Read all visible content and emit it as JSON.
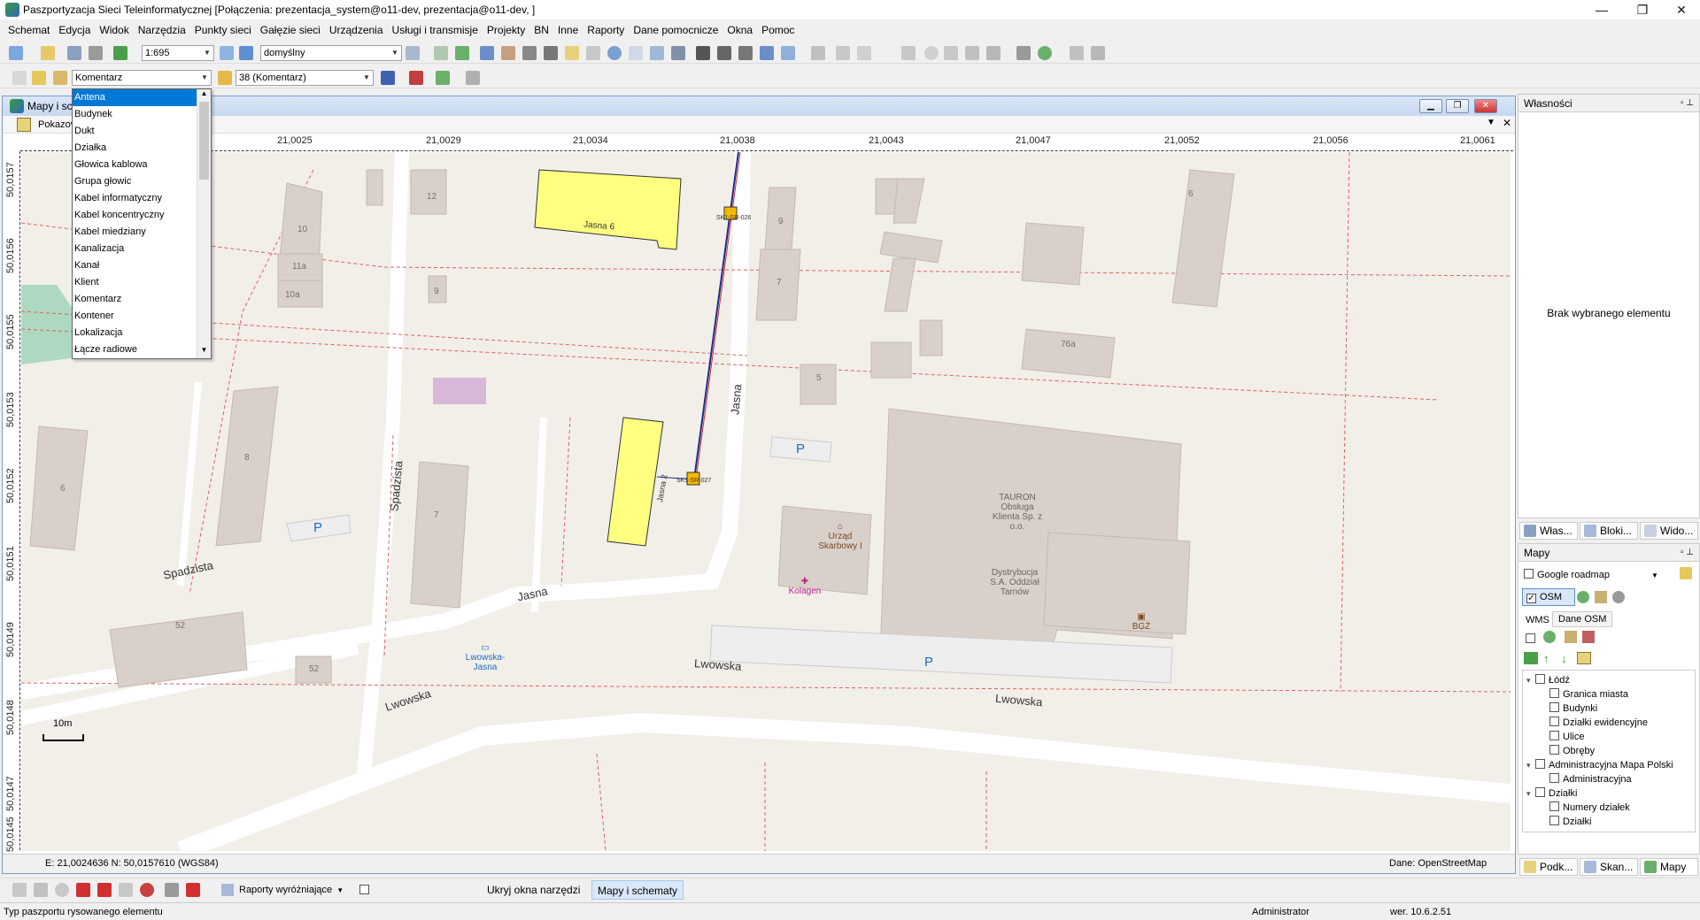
{
  "app": {
    "title": "Paszportyzacja Sieci Teleinformatycznej [Połączenia: prezentacja_system@o11-dev, prezentacja@o11-dev, ]",
    "window_buttons": [
      "—",
      "❐",
      "✕"
    ]
  },
  "menu": [
    "Schemat",
    "Edycja",
    "Widok",
    "Narzędzia",
    "Punkty sieci",
    "Gałęzie sieci",
    "Urządzenia",
    "Usługi i transmisje",
    "Projekty",
    "BN",
    "Inne",
    "Raporty",
    "Dane pomocnicze",
    "Okna",
    "Pomoc"
  ],
  "toolbar1": {
    "scale_value": "1:695",
    "style_value": "domyślny"
  },
  "toolbar2": {
    "type_value": "Komentarz",
    "layer_value": "38 (Komentarz)"
  },
  "dropdown": {
    "items": [
      "Antena",
      "Budynek",
      "Dukt",
      "Działka",
      "Głowica kablowa",
      "Grupa głowic",
      "Kabel informatyczny",
      "Kabel koncentryczny",
      "Kabel miedziany",
      "Kanalizacja",
      "Kanał",
      "Klient",
      "Komentarz",
      "Kontener",
      "Lokalizacja",
      "Łącze radiowe"
    ],
    "selected": "Antena"
  },
  "mdi": {
    "title": "Mapy i sc",
    "sub_label": "Pokazov",
    "coords": "E: 21,0024636  N: 50,0157610 (WGS84)",
    "data_source": "Dane: OpenStreetMap",
    "scale_bar": "10m"
  },
  "ruler_top": [
    "21,0025",
    "21,0029",
    "21,0034",
    "21,0038",
    "21,0043",
    "21,0047",
    "21,0052",
    "21,0056",
    "21,0061"
  ],
  "ruler_left": [
    "50,0157",
    "50,0156",
    "50,0155",
    "50,0153",
    "50,0152",
    "50,0151",
    "50,0149",
    "50,0148",
    "50,0147",
    "50,0145"
  ],
  "map_labels": {
    "streets": [
      "Spadzista",
      "Spadzista",
      "Jasna",
      "Jasna",
      "Jasna",
      "Lwowska",
      "Lwowska",
      "Lwowska"
    ],
    "house_numbers": [
      "12",
      "10",
      "11a",
      "10a",
      "9",
      "8",
      "6",
      "7",
      "52",
      "52",
      "9",
      "7",
      "5",
      "6",
      "76a"
    ],
    "jasna6": "Jasna 6",
    "jasna_small": "Jasna 2",
    "sk1": "SK1-SR-026",
    "sk2": "SK1-SR-027",
    "parking": [
      "P",
      "P",
      "P"
    ],
    "poi_office": "Urząd Skarbowy I",
    "poi_tauron": "TAURON Obsługa Klienta Sp. z o.o.",
    "poi_dystr": "Dystrybucja S.A. Oddział Tarnów",
    "poi_kolagen": "Kolagen",
    "poi_bgz": "BGŻ",
    "poi_bus": "Lwowska-Jasna"
  },
  "right_panel": {
    "props_title": "Własności",
    "props_empty": "Brak wybranego elementu",
    "tabs1": [
      "Włas...",
      "Bloki...",
      "Wido..."
    ],
    "maps_title": "Mapy",
    "google_label": "Google roadmap",
    "osm_label": "OSM",
    "sub_tabs": [
      "WMS",
      "Dane OSM"
    ],
    "tree": [
      {
        "label": "Łódź",
        "level": 0,
        "toggle": "▾",
        "checked": false
      },
      {
        "label": "Granica miasta",
        "level": 1,
        "checked": false
      },
      {
        "label": "Budynki",
        "level": 1,
        "checked": false
      },
      {
        "label": "Działki ewidencyjne",
        "level": 1,
        "checked": false
      },
      {
        "label": "Ulice",
        "level": 1,
        "checked": false
      },
      {
        "label": "Obręby",
        "level": 1,
        "checked": false
      },
      {
        "label": "Administracyjna Mapa Polski",
        "level": 0,
        "toggle": "▾",
        "checked": false
      },
      {
        "label": "Administracyjna",
        "level": 1,
        "checked": false
      },
      {
        "label": "Działki",
        "level": 0,
        "toggle": "▾",
        "checked": false
      },
      {
        "label": "Numery działek",
        "level": 1,
        "checked": false
      },
      {
        "label": "Działki",
        "level": 1,
        "checked": false
      }
    ],
    "tabs2": [
      "Podk...",
      "Skan...",
      "Mapy"
    ]
  },
  "bottombar": {
    "reports": "Raporty wyróżniające",
    "hide_tools": "Ukryj okna narzędzi",
    "maps_schemes": "Mapy i schematy"
  },
  "statusbar": {
    "hint": "Typ paszportu rysowanego elementu",
    "user": "Administrator",
    "version": "wer. 10.6.2.51"
  },
  "colors": {
    "map_bg": "#f2efe9",
    "building": "#d9d0c9",
    "highlight_building": "#ffff80",
    "selection": "#0078d7",
    "street": "#ffffff",
    "boundary": "#e06060"
  }
}
